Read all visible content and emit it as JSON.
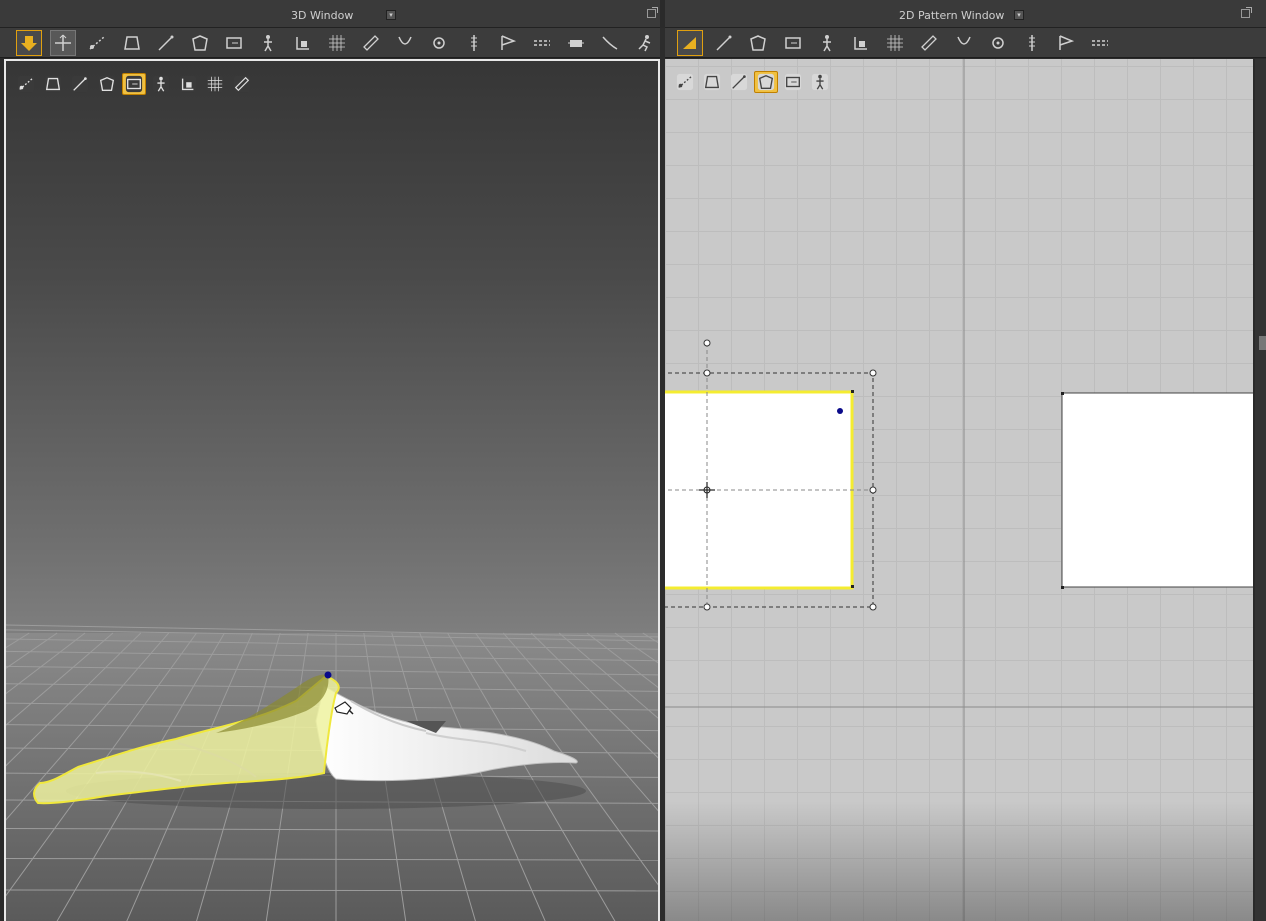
{
  "windows": {
    "left": {
      "title": "3D Window",
      "dropdown_icon": "chevron-down-icon",
      "undock_icon": "undock-icon"
    },
    "right": {
      "title": "2D Pattern Window",
      "dropdown_icon": "chevron-down-icon",
      "undock_icon": "undock-icon"
    }
  },
  "toolbar3d": {
    "tools": [
      "pin-arrow-icon",
      "move-icon",
      "fold-icon",
      "garment-icon",
      "line-icon",
      "shirt-arrange-icon",
      "arrow-box-icon",
      "avatar-icon",
      "tack-icon",
      "grid-icon",
      "measure-icon",
      "sew-icon",
      "button-icon",
      "zipper-icon",
      "pin-icon",
      "seam-icon",
      "strap-icon",
      "tuck-icon",
      "pose-icon"
    ],
    "active_index": 1,
    "highlight_index": 0
  },
  "toolbar2d": {
    "tools": [
      "transform-pattern-icon",
      "edit-point-icon",
      "rectangle-icon",
      "internal-rect-icon",
      "avatar-fit-icon",
      "segment-icon",
      "grid-icon",
      "iron-icon",
      "sew-icon",
      "fold-icon",
      "pleat-icon",
      "line-icon",
      "shirt-icon"
    ],
    "active_index": 0
  },
  "viewport3d_icons": {
    "items": [
      "fabric-solid-icon",
      "shirt-texture-icon",
      "flower-icon",
      "avatar-view-icon",
      "pattern-select-icon",
      "half-shape-icon",
      "head-icon",
      "globe-icon",
      "export-icon"
    ],
    "selected_index": 4
  },
  "viewport2d_icons": {
    "items": [
      "pen-icon",
      "shirt-outline-icon",
      "info-icon",
      "pattern-select-icon",
      "texture-icon",
      "export-icon"
    ],
    "selected_index": 3
  },
  "colors": {
    "accent": "#e8b020",
    "selection_yellow": "#f0e83c",
    "pin_blue": "#0a0a8a"
  }
}
